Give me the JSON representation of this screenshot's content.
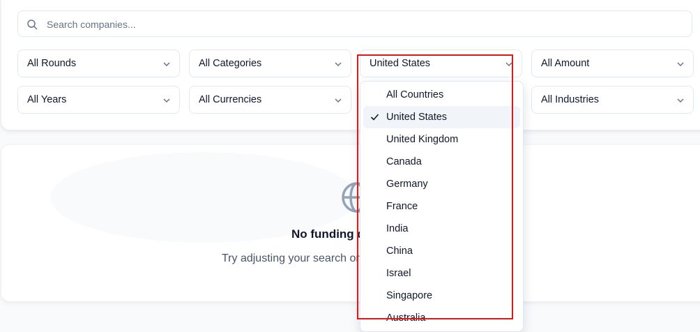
{
  "search": {
    "placeholder": "Search companies..."
  },
  "filters": {
    "rounds": "All Rounds",
    "categories": "All Categories",
    "country": "United States",
    "amount": "All Amount",
    "years": "All Years",
    "currencies": "All Currencies",
    "industries": "All Industries"
  },
  "country_dropdown": {
    "options": [
      {
        "label": "All Countries",
        "selected": false
      },
      {
        "label": "United States",
        "selected": true
      },
      {
        "label": "United Kingdom",
        "selected": false
      },
      {
        "label": "Canada",
        "selected": false
      },
      {
        "label": "Germany",
        "selected": false
      },
      {
        "label": "France",
        "selected": false
      },
      {
        "label": "India",
        "selected": false
      },
      {
        "label": "China",
        "selected": false
      },
      {
        "label": "Israel",
        "selected": false
      },
      {
        "label": "Singapore",
        "selected": false
      },
      {
        "label": "Australia",
        "selected": false
      }
    ]
  },
  "empty_state": {
    "title": "No funding data found",
    "subtitle": "Try adjusting your search or filters"
  },
  "colors": {
    "highlight": "#e01818",
    "selected_bg": "#f1f5f9",
    "icon": "#94a3b8"
  }
}
